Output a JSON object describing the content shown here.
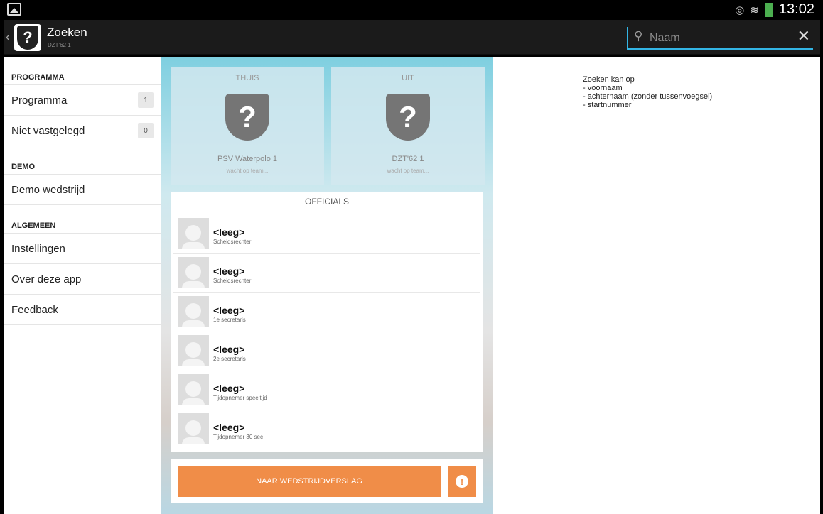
{
  "status_bar": {
    "time": "13:02",
    "icons": [
      "image-icon",
      "eye-icon",
      "wifi-icon",
      "battery-icon"
    ]
  },
  "action_bar": {
    "title": "Zoeken",
    "subtitle": "DZT'62 1",
    "logo_symbol": "?",
    "search_placeholder": "Naam",
    "search_value": ""
  },
  "sidebar": {
    "sections": [
      {
        "header": "PROGRAMMA",
        "items": [
          {
            "label": "Programma",
            "badge": "1"
          },
          {
            "label": "Niet vastgelegd",
            "badge": "0"
          }
        ]
      },
      {
        "header": "DEMO",
        "items": [
          {
            "label": "Demo wedstrijd"
          }
        ]
      },
      {
        "header": "ALGEMEEN",
        "items": [
          {
            "label": "Instellingen"
          },
          {
            "label": "Over deze app"
          },
          {
            "label": "Feedback"
          }
        ]
      }
    ]
  },
  "match": {
    "home": {
      "label": "THUIS",
      "symbol": "?",
      "team": "PSV Waterpolo 1",
      "status": "wacht op team..."
    },
    "away": {
      "label": "UIT",
      "symbol": "?",
      "team": "DZT'62 1",
      "status": "wacht op team..."
    }
  },
  "officials": {
    "title": "OFFICIALS",
    "rows": [
      {
        "name": "<leeg>",
        "role": "Scheidsrechter"
      },
      {
        "name": "<leeg>",
        "role": "Scheidsrechter"
      },
      {
        "name": "<leeg>",
        "role": "1e secretaris"
      },
      {
        "name": "<leeg>",
        "role": "2e secretaris"
      },
      {
        "name": "<leeg>",
        "role": "Tijdopnemer speeltijd"
      },
      {
        "name": "<leeg>",
        "role": "Tijdopnemer 30 sec"
      }
    ]
  },
  "actions": {
    "report_button": "NAAR WEDSTRIJDVERSLAG",
    "alert_symbol": "!"
  },
  "help": {
    "lines": [
      "Zoeken kan op",
      "- voornaam",
      "- achternaam (zonder tussenvoegsel)",
      "- startnummer"
    ]
  },
  "colors": {
    "accent_orange": "#f08d48",
    "search_underline": "#33b5e5",
    "battery": "#4caf50"
  }
}
